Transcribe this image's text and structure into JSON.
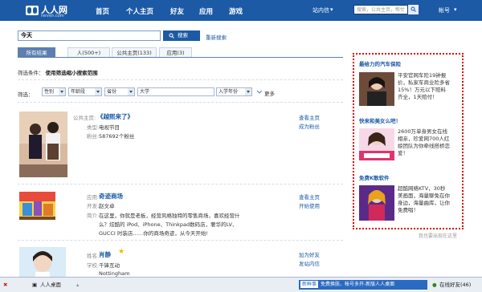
{
  "topbar": {
    "logo_text": "人人网",
    "logo_sub": "renren.com",
    "nav": [
      "首页",
      "个人主页",
      "好友",
      "应用",
      "游戏"
    ],
    "messages": "站内信",
    "search_placeholder": "搜索，公共主页，帮忙",
    "account": "帐号"
  },
  "search": {
    "query": "今天",
    "button": "搜索",
    "reset": "重新搜索"
  },
  "tabs": [
    "所有结果",
    "人(500+)",
    "公共主页(133)",
    "应用(3)"
  ],
  "filter": {
    "condition_label": "筛选条件：",
    "condition_value": "使用筛选缩小搜索范围",
    "label": "筛选：",
    "gender": "性别",
    "age": "年龄段",
    "province": "省份",
    "school": "大学",
    "year": "入学年份",
    "more": "更多"
  },
  "results": [
    {
      "l1": "公共主页:",
      "v1": "《越熙来了》",
      "l2": "类型:",
      "v2": "电视节目",
      "l3": "粉丝:",
      "v3": "587692个粉丝",
      "actions": [
        "查看主页",
        "成为粉丝"
      ]
    },
    {
      "l1": "应用:",
      "v1": "奇迹商场",
      "l2": "开发:",
      "v2": "赵文卓",
      "l3": "简介:",
      "desc": [
        "在这里，你就是老板，经营风格独特的零售商场，喜欢经营什",
        "么？炫酷的 iPod、iPhone、Thinkpad数码店，奢华的LV、",
        "GUCCI 时装店……你的商场奇迹，从今天开始!"
      ],
      "actions": [
        "查看主页",
        "开始使用"
      ]
    },
    {
      "l1": "姓名:",
      "v1": "肖静",
      "l2": "学校:",
      "v2": "千锋互动",
      "v3": "Nottingham",
      "actions": [
        "加为好友",
        "发站内信"
      ]
    }
  ],
  "ads": [
    {
      "title": "最给力的汽车保险",
      "text": "平安官网车险19钟报价，私家车商业险多省15%！万元以下赔料齐全，1天赔付！"
    },
    {
      "title": "快来和美女么吧！",
      "text": "2600万单身男女在线相亲，珍爱网700人红娘团队为你牵线搭桥恋爱！"
    },
    {
      "title": "免费K歌软件",
      "text": "超酷网络KTV，30秒美画面，海量聊免在你身边，海量曲库，让你免费唱！"
    }
  ],
  "ads_footer": "我也要出现在这里",
  "taskbar": {
    "start": "人人桌面",
    "news_tag": "新鲜事",
    "news": "免费换肤、帐号多开-新版人人桌面",
    "online": "在线好友(46)"
  }
}
